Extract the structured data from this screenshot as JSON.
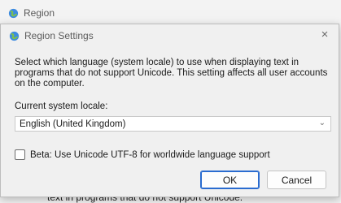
{
  "background_window": {
    "title": "Region",
    "bottom_text": "text in programs that do not support Unicode."
  },
  "dialog": {
    "title": "Region Settings",
    "description": "Select which language (system locale) to use when displaying text in programs that do not support Unicode. This setting affects all user accounts on the computer.",
    "locale_label": "Current system locale:",
    "locale_value": "English (United Kingdom)",
    "beta_label": "Beta: Use Unicode UTF-8 for worldwide language support",
    "beta_checked": false,
    "ok_label": "OK",
    "cancel_label": "Cancel"
  },
  "icons": {
    "app": "globe-icon",
    "close": "close-icon",
    "dropdown": "chevron-down-icon"
  },
  "colors": {
    "accent": "#2a6cd0"
  }
}
